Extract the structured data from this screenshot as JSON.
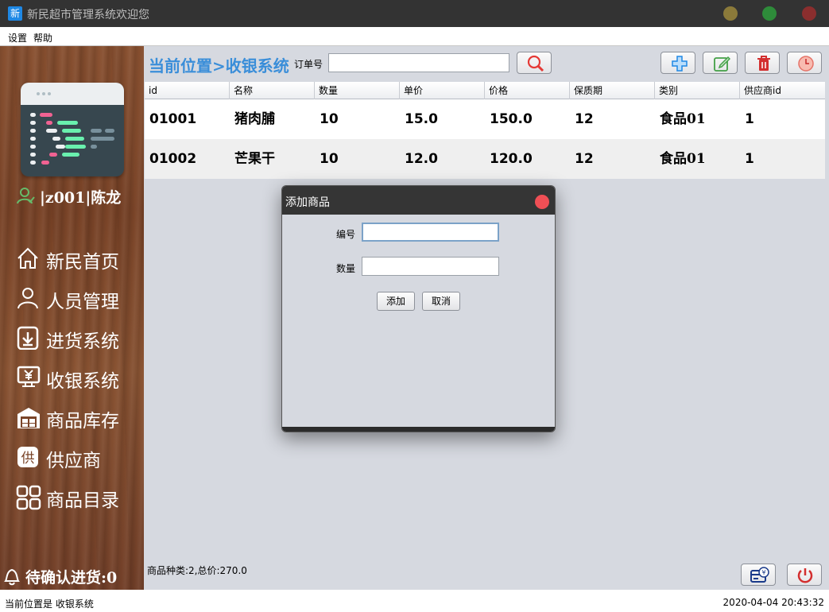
{
  "window": {
    "logo_char": "新",
    "title": "新民超市管理系统欢迎您",
    "controls": {
      "minimize_color": "#8b7a3a",
      "maximize_color": "#2e8b3a",
      "close_color": "#8b2e2e"
    }
  },
  "menu": {
    "settings": "设置",
    "help": "帮助"
  },
  "sidebar": {
    "user": "|z001|陈龙",
    "nav": [
      {
        "label": "新民首页",
        "icon": "home-icon"
      },
      {
        "label": "人员管理",
        "icon": "person-icon"
      },
      {
        "label": "进货系统",
        "icon": "download-icon"
      },
      {
        "label": "收银系统",
        "icon": "cashier-icon"
      },
      {
        "label": "商品库存",
        "icon": "warehouse-icon"
      },
      {
        "label": "供应商",
        "icon": "supplier-icon"
      },
      {
        "label": "商品目录",
        "icon": "grid-icon"
      }
    ],
    "pending": "待确认进货:0"
  },
  "main": {
    "breadcrumb": "当前位置>收银系统",
    "order_label": "订单号",
    "order_value": "",
    "toolbar": {
      "search": "search-icon",
      "add": "plus-icon",
      "edit": "edit-icon",
      "delete": "trash-icon",
      "clear": "clock-icon"
    },
    "table": {
      "columns": [
        "id",
        "名称",
        "数量",
        "单价",
        "价格",
        "保质期",
        "类别",
        "供应商id"
      ],
      "rows": [
        [
          "01001",
          "猪肉脯",
          "10",
          "15.0",
          "150.0",
          "12",
          "食品01",
          "1"
        ],
        [
          "01002",
          "芒果干",
          "10",
          "12.0",
          "120.0",
          "12",
          "食品01",
          "1"
        ]
      ]
    },
    "summary": "商品种类:2,总价:270.0"
  },
  "dialog": {
    "title": "添加商品",
    "code_label": "编号",
    "code_value": "",
    "qty_label": "数量",
    "qty_value": "",
    "add_label": "添加",
    "cancel_label": "取消"
  },
  "status": {
    "left": "当前位置是 收银系统",
    "right": "2020-04-04 20:43:32"
  },
  "colors": {
    "accent": "#3a8ed9",
    "delete": "#d32f2f",
    "add": "#1e88e5",
    "edit": "#43a047"
  }
}
